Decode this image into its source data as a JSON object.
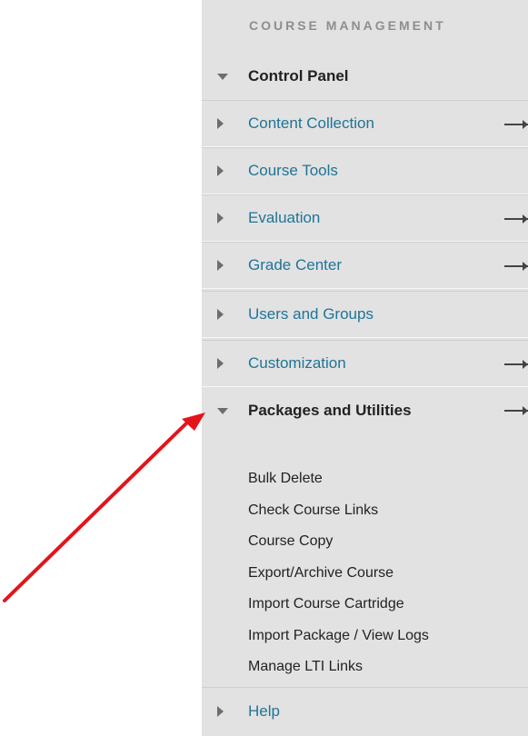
{
  "panel": {
    "section_title": "COURSE MANAGEMENT",
    "control_panel_label": "Control Panel",
    "items": [
      {
        "label": "Content Collection",
        "has_arrow": true
      },
      {
        "label": "Course Tools",
        "has_arrow": false
      },
      {
        "label": "Evaluation",
        "has_arrow": true
      },
      {
        "label": "Grade Center",
        "has_arrow": true
      },
      {
        "label": "Users and Groups",
        "has_arrow": false
      },
      {
        "label": "Customization",
        "has_arrow": true
      }
    ],
    "packages": {
      "label": "Packages and Utilities",
      "sub_items": [
        "Bulk Delete",
        "Check Course Links",
        "Course Copy",
        "Export/Archive Course",
        "Import Course Cartridge",
        "Import Package / View Logs",
        "Manage LTI Links"
      ]
    },
    "help_label": "Help"
  },
  "icons": {
    "collapsed": "triangle-right-icon",
    "expanded": "triangle-down-icon",
    "go": "arrow-right-icon",
    "annotation": "red-arrow-annotation"
  },
  "colors": {
    "panel_bg": "#e2e2e2",
    "link": "#1f7497",
    "annotation": "#e3141b"
  }
}
